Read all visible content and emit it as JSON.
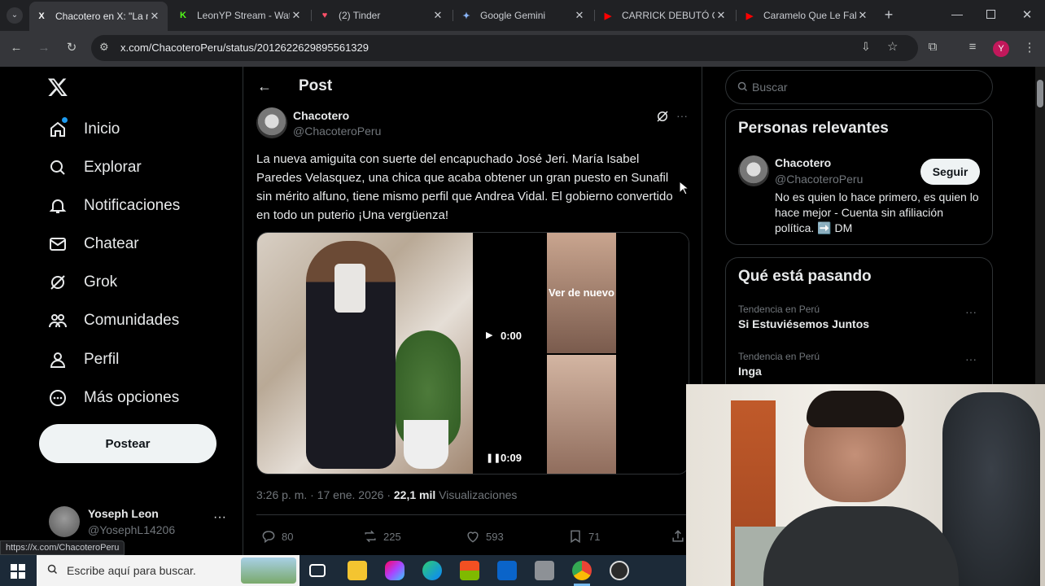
{
  "browser": {
    "tabs": [
      {
        "title": "Chacotero en X: \"La n",
        "fav": "X",
        "favcolor": "#ffffff",
        "active": true
      },
      {
        "title": "LeonYP Stream - Wat",
        "fav": "K",
        "favcolor": "#53fc18",
        "active": false
      },
      {
        "title": "(2) Tinder",
        "fav": "♥",
        "favcolor": "#fd5068",
        "active": false
      },
      {
        "title": "Google Gemini",
        "fav": "✦",
        "favcolor": "#8ab4f8",
        "active": false
      },
      {
        "title": "CARRICK DEBUTÓ CO",
        "fav": "▶",
        "favcolor": "#ff0000",
        "active": false
      },
      {
        "title": "Caramelo Que Le Falt",
        "fav": "▶",
        "favcolor": "#ff0000",
        "active": false
      }
    ],
    "url": "x.com/ChacoteroPeru/status/2012622629895561329",
    "profile_initial": "Y",
    "status_url": "https://x.com/ChacoteroPeru"
  },
  "nav": {
    "items": [
      {
        "label": "Inicio",
        "icon": "home-icon"
      },
      {
        "label": "Explorar",
        "icon": "search-icon"
      },
      {
        "label": "Notificaciones",
        "icon": "bell-icon"
      },
      {
        "label": "Chatear",
        "icon": "mail-icon"
      },
      {
        "label": "Grok",
        "icon": "grok-icon"
      },
      {
        "label": "Comunidades",
        "icon": "people-icon"
      },
      {
        "label": "Perfil",
        "icon": "person-icon"
      },
      {
        "label": "Más opciones",
        "icon": "more-circle-icon"
      }
    ],
    "post_button": "Postear",
    "account": {
      "name": "Yoseph Leon",
      "handle": "@YosephL14206"
    }
  },
  "post": {
    "header_title": "Post",
    "author": {
      "name": "Chacotero",
      "handle": "@ChacoteroPeru"
    },
    "text": "La nueva amiguita con suerte del encapuchado José Jeri. María Isabel Paredes Velasquez, una chica que acaba obtener un gran puesto en Sunafil sin mérito alfuno, tiene mismo perfil que Andrea Vidal. El gobierno convertido en todo un puterio ¡Una vergüenza!",
    "media": {
      "replay_label": "Ver de nuevo",
      "time_top": "0:00",
      "time_bottom": "0:09"
    },
    "meta": {
      "time": "3:26 p. m. · 17 ene. 2026 · ",
      "views_count": "22,1 mil",
      "views_label": " Visualizaciones"
    },
    "stats": {
      "replies": "80",
      "reposts": "225",
      "likes": "593",
      "bookmarks": "71"
    }
  },
  "sidebar": {
    "search_placeholder": "Buscar",
    "relevant": {
      "title": "Personas relevantes",
      "name": "Chacotero",
      "handle": "@ChacoteroPeru",
      "follow": "Seguir",
      "bio": "No es quien lo hace primero, es quien lo hace mejor - Cuenta sin afiliación política. ➡️ DM"
    },
    "trends": {
      "title": "Qué está pasando",
      "items": [
        {
          "context": "Tendencia en Perú",
          "name": "Si Estuviésemos Juntos"
        },
        {
          "context": "Tendencia en Perú",
          "name": "Inga"
        }
      ]
    }
  },
  "taskbar": {
    "search_placeholder": "Escribe aquí para buscar."
  }
}
